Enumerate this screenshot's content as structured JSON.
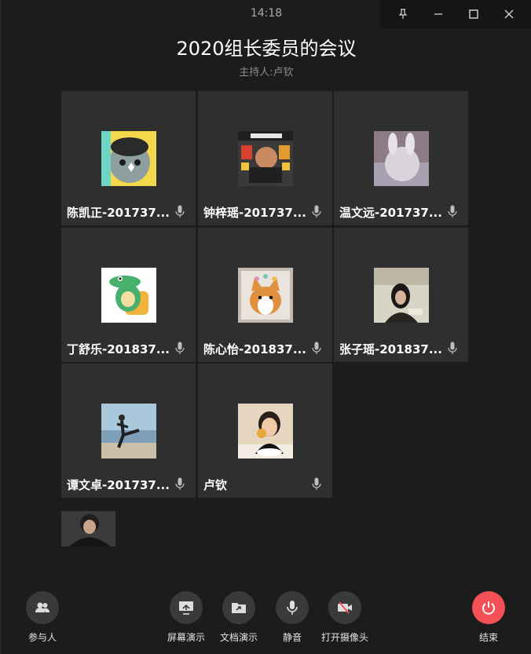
{
  "clock": "14:18",
  "meeting": {
    "title": "2020组长委员的会议",
    "host_line": "主持人:卢钦"
  },
  "participants": [
    {
      "name": "陈凯正-201737...",
      "avatar": "cartoon-face-avatar"
    },
    {
      "name": "钟梓瑶-201737...",
      "avatar": "burger-king-avatar"
    },
    {
      "name": "温文远-201737...",
      "avatar": "bunny-hat-avatar"
    },
    {
      "name": "丁舒乐-201837...",
      "avatar": "green-crocodile-avatar"
    },
    {
      "name": "陈心怡-201837...",
      "avatar": "corgi-avatar"
    },
    {
      "name": "张子瑶-201837...",
      "avatar": "girl-photo-avatar"
    },
    {
      "name": "谭文卓-201737...",
      "avatar": "beach-kick-avatar"
    },
    {
      "name": "卢钦",
      "avatar": "child-eating-avatar"
    }
  ],
  "toolbar": {
    "participants": "参与人",
    "screen_share": "屏幕演示",
    "doc_share": "文档演示",
    "mute": "静音",
    "camera": "打开摄像头",
    "end": "结束"
  },
  "colors": {
    "background": "#1c1c1c",
    "tile": "#2f2f2f",
    "end_button": "#f55056",
    "tool_button": "#3a3a3a"
  }
}
